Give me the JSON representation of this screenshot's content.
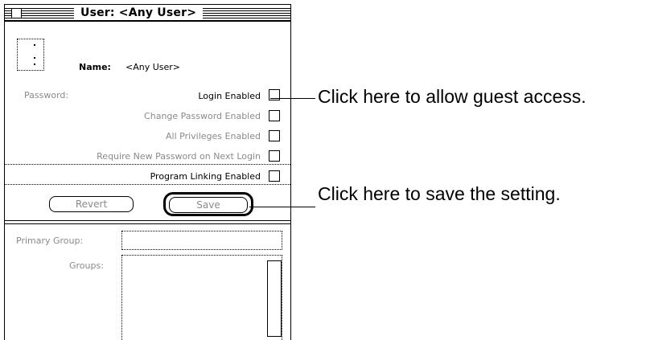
{
  "window": {
    "title": "User: <Any User>"
  },
  "user": {
    "name_label": "Name:",
    "name_value": "<Any User>"
  },
  "password": {
    "label": "Password:",
    "options": [
      {
        "label": "Login Enabled",
        "checked": false,
        "enabled": true
      },
      {
        "label": "Change Password Enabled",
        "checked": false,
        "enabled": false
      },
      {
        "label": "All Privileges Enabled",
        "checked": false,
        "enabled": false
      },
      {
        "label": "Require New Password on Next Login",
        "checked": false,
        "enabled": false
      }
    ]
  },
  "program_linking": {
    "label": "Program Linking Enabled",
    "checked": false
  },
  "buttons": {
    "revert": "Revert",
    "save": "Save"
  },
  "groups": {
    "primary_label": "Primary Group:",
    "primary_value": "",
    "groups_label": "Groups:"
  },
  "callouts": {
    "guest_access": "Click here to allow guest access.",
    "save_setting": "Click here to save the setting."
  },
  "colors": {
    "dimmed_text": "#8a8a8a",
    "foreground": "#000000",
    "background": "#ffffff"
  }
}
